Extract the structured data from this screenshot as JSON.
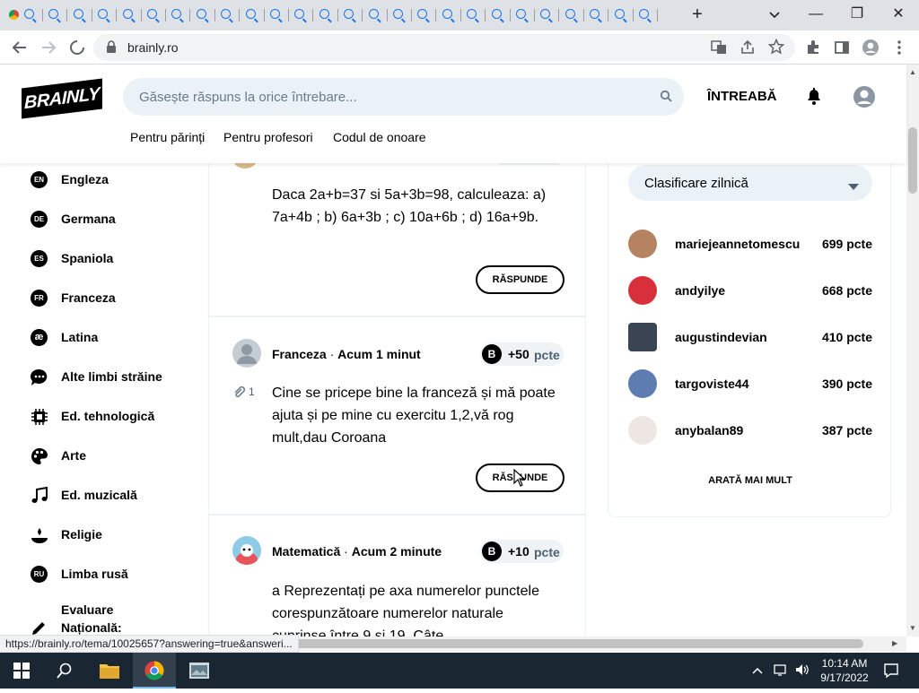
{
  "browser": {
    "tab_favicon_count": 26,
    "new_tab_label": "+",
    "window_controls": {
      "minimize": "—",
      "restore": "❐",
      "close": "✕"
    },
    "url": "brainly.ro",
    "status_url": "https://brainly.ro/tema/10025657?answering=true&answeri..."
  },
  "site": {
    "logo": "BRAINLY",
    "search_placeholder": "Găsește răspuns la orice întrebare...",
    "ask_label": "ÎNTREABĂ",
    "sublinks": [
      "Pentru părinți",
      "Pentru profesori",
      "Codul de onoare"
    ],
    "accent_color": "#000000",
    "search_bg": "#ebf2f7"
  },
  "sidebar": {
    "items": [
      {
        "badge": "EN",
        "label": "Engleza",
        "icon": "en-badge-icon"
      },
      {
        "badge": "DE",
        "label": "Germana",
        "icon": "de-badge-icon"
      },
      {
        "badge": "ES",
        "label": "Spaniola",
        "icon": "es-badge-icon"
      },
      {
        "badge": "FR",
        "label": "Franceza",
        "icon": "fr-badge-icon"
      },
      {
        "badge": "æ",
        "label": "Latina",
        "icon": "latina-icon"
      },
      {
        "badge": "",
        "label": "Alte limbi străine",
        "icon": "speech-bubble-icon"
      },
      {
        "badge": "",
        "label": "Ed. tehnologică",
        "icon": "chip-icon"
      },
      {
        "badge": "",
        "label": "Arte",
        "icon": "palette-icon"
      },
      {
        "badge": "",
        "label": "Ed. muzicală",
        "icon": "music-note-icon"
      },
      {
        "badge": "",
        "label": "Religie",
        "icon": "candle-icon"
      },
      {
        "badge": "RU",
        "label": "Limba rusă",
        "icon": "ru-badge-icon"
      },
      {
        "badge": "",
        "label": "Evaluare Națională:",
        "icon": "pencil-icon"
      }
    ]
  },
  "feed": {
    "answer_label": "RĂSPUNDE",
    "points_unit": "pcte",
    "questions": [
      {
        "text": "Daca 2a+b=37 si 5a+3b=98, calculeaza: a) 7a+4b ; b) 6a+3b ; c) 10a+6b ; d) 16a+9b."
      },
      {
        "subject": "Franceza",
        "time": "Acum 1 minut",
        "points": "+50",
        "attachments": "1",
        "text": "Cine se pricepe bine la franceză și mă poate ajuta și pe mine cu exercitu 1,2,vă rog mult,dau Coroana"
      },
      {
        "subject": "Matematică",
        "time": "Acum 2 minute",
        "points": "+10",
        "text": "a Reprezentați pe axa numerelor punctele corespunzătoare numerelor naturale cuprinse între 9 și 19. Câte"
      }
    ]
  },
  "ranking": {
    "dropdown_label": "Clasificare zilnică",
    "rows": [
      {
        "name": "mariejeannetomescu",
        "points": "699 pcte"
      },
      {
        "name": "andyilye",
        "points": "668 pcte"
      },
      {
        "name": "augustindevian",
        "points": "410 pcte"
      },
      {
        "name": "targoviste44",
        "points": "390 pcte"
      },
      {
        "name": "anybalan89",
        "points": "387 pcte"
      }
    ],
    "show_more": "ARATĂ MAI MULT"
  },
  "taskbar": {
    "time": "10:14 AM",
    "date": "9/17/2022"
  }
}
